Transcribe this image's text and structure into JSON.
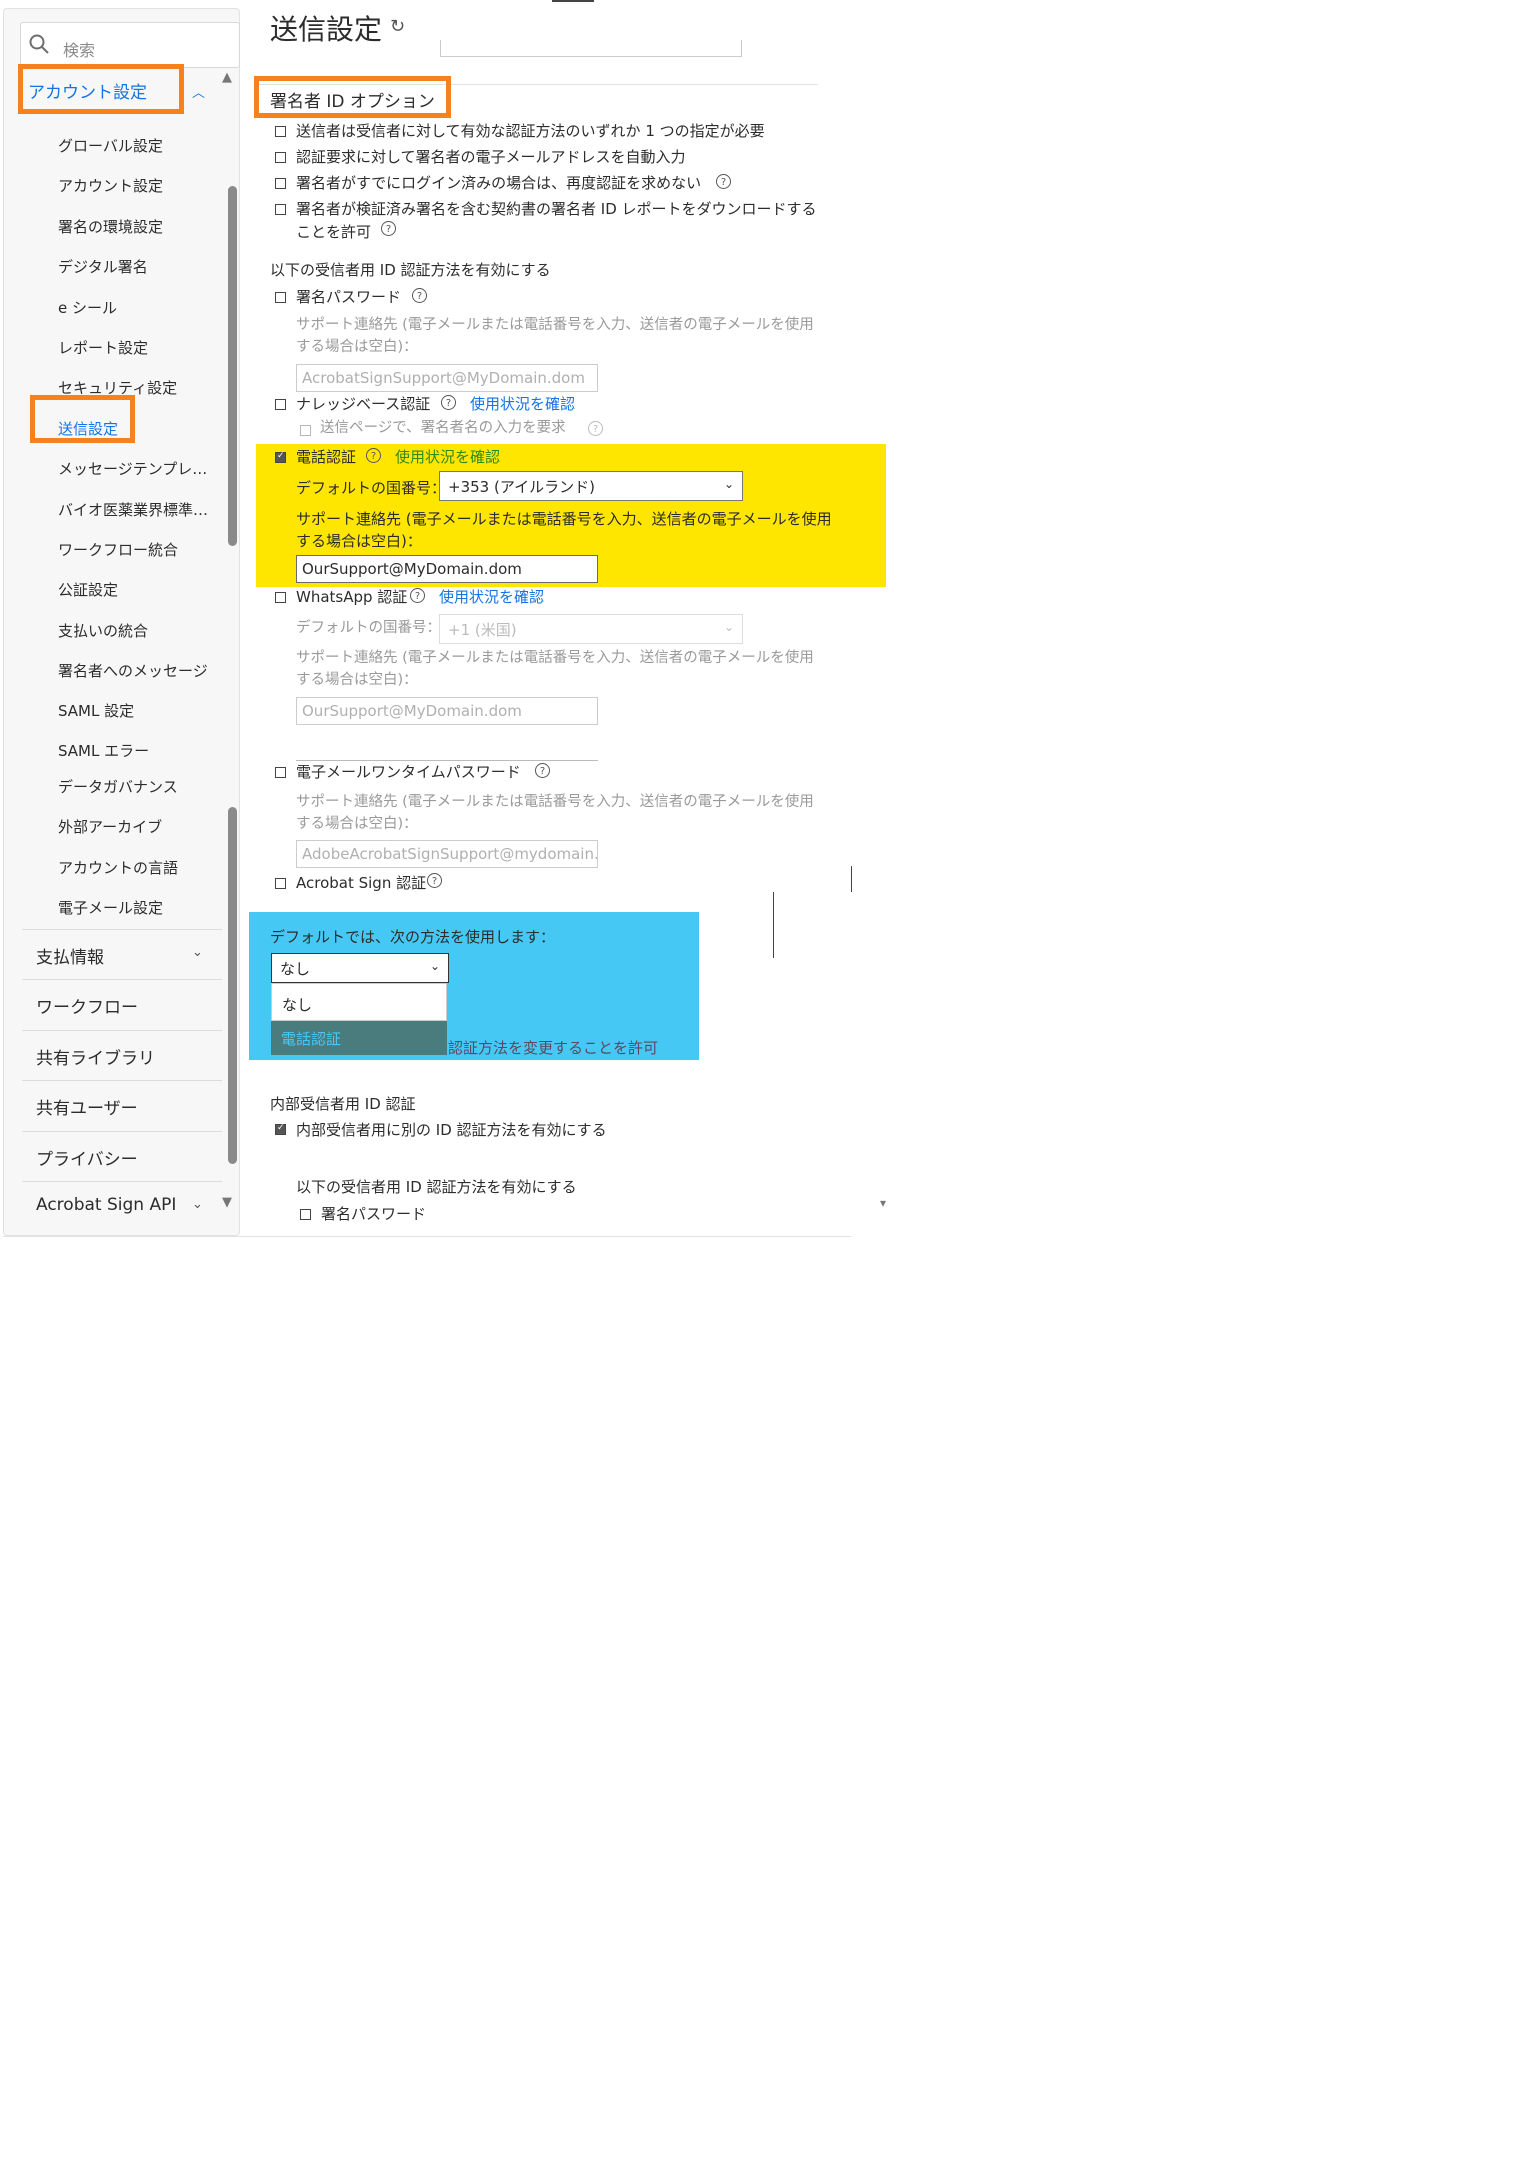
{
  "page": {
    "title": "送信設定",
    "refresh_icon": "refresh-icon"
  },
  "sidebar": {
    "search_placeholder": "検索",
    "account_section": "アカウント設定",
    "sub_items": [
      "グローバル設定",
      "アカウント設定",
      "署名の環境設定",
      "デジタル署名",
      "e シール",
      "レポート設定",
      "セキュリティ設定",
      "送信設定",
      "メッセージテンプレ…",
      "バイオ医薬業界標準…",
      "ワークフロー統合",
      "公証設定",
      "支払いの統合",
      "署名者へのメッセージ",
      "SAML 設定",
      "SAML エラー",
      "データガバナンス",
      "外部アーカイブ",
      "アカウントの言語",
      "電子メール設定"
    ],
    "active_sub_item": "送信設定",
    "main_items": [
      "支払情報",
      "ワークフロー",
      "共有ライブラリ",
      "共有ユーザー",
      "プライバシー",
      "Acrobat Sign API"
    ]
  },
  "signer_id": {
    "section_title": "署名者 ID オプション",
    "options": [
      "送信者は受信者に対して有効な認証方法のいずれか 1 つの指定が必要",
      "認証要求に対して署名者の電子メールアドレスを自動入力",
      "署名者がすでにログイン済みの場合は、再度認証を求めない",
      "署名者が検証済み署名を含む契約書の署名者 ID レポートをダウンロードする",
      "ことを許可"
    ],
    "methods_heading": "以下の受信者用 ID 認証方法を有効にする",
    "support_label_line1": "サポート連絡先 (電子メールまたは電話番号を入力、送信者の電子メールを使用",
    "support_label_line2": "する場合は空白)：",
    "country_label": "デフォルトの国番号：",
    "view_usage": "使用状況を確認",
    "password": {
      "label": "署名パスワード",
      "support": "AcrobatSignSupport@MyDomain.dom"
    },
    "kba": {
      "label": "ナレッジベース認証",
      "sub_option": "送信ページで、署名者名の入力を要求"
    },
    "phone": {
      "label": "電話認証",
      "country": "+353 (アイルランド)",
      "support": "OurSupport@MyDomain.dom"
    },
    "whatsapp": {
      "label": "WhatsApp 認証",
      "country": "+1 (米国)",
      "support": "OurSupport@MyDomain.dom"
    },
    "email_otp": {
      "label": "電子メールワンタイムパスワード",
      "support": "AdobeAcrobatSignSupport@mydomain.dom"
    },
    "acrobat_sign": {
      "label": "Acrobat Sign 認証"
    }
  },
  "default_method": {
    "label": "デフォルトでは、次の方法を使用します：",
    "selected": "なし",
    "options": [
      "なし",
      "電話認証"
    ],
    "behind_text": "認証方法を変更することを許可"
  },
  "internal": {
    "heading": "内部受信者用 ID 認証",
    "enable_label": "内部受信者用に別の ID 認証方法を有効にする",
    "methods_heading": "以下の受信者用 ID 認証方法を有効にする",
    "password_label": "署名パスワード"
  },
  "colors": {
    "highlight_orange": "#f5821f",
    "highlight_yellow": "#ffe600",
    "highlight_blue": "#46c8f5",
    "link_blue": "#1473e6"
  }
}
